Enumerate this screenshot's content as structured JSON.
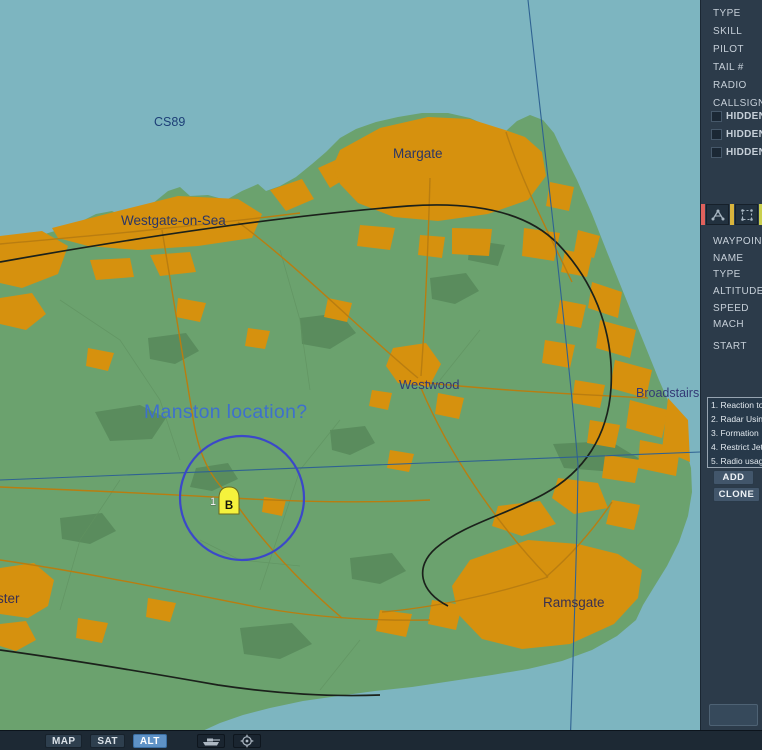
{
  "map": {
    "region_labels": {
      "cs89": "CS89",
      "margate": "Margate",
      "westgate": "Westgate-on-Sea",
      "westwood": "Westwood",
      "broadstairs": "Broadstairs",
      "ramsgate": "Ramsgate",
      "minster_partial": "ster"
    },
    "annotation": "Manston location?",
    "marker": {
      "number": "1",
      "letter": "B"
    },
    "colors": {
      "sea": "#7db5c0",
      "land": "#6ba26e",
      "woodland": "#5a8c5d",
      "urban": "#d6910e",
      "road": "#b97d10",
      "railway": "#1b211b",
      "grid_line": "#2f6292",
      "circle_annotation": "#3b48c9",
      "marker_fill": "#f5f23c",
      "town_label": "#2b3666",
      "annotation_text": "#3e70cc"
    }
  },
  "sidebar": {
    "unit_fields": [
      "TYPE",
      "SKILL",
      "PILOT",
      "TAIL #",
      "RADIO",
      "CALLSIGN"
    ],
    "hidden_rows": [
      "HIDDEN",
      "HIDDEN",
      "HIDDEN"
    ],
    "waypoint_fields": [
      "WAYPOINT",
      "NAME",
      "TYPE",
      "ALTITUDE",
      "SPEED",
      "MACH",
      "START"
    ],
    "advanced_actions": [
      "1. Reaction to",
      "2. Radar Usin",
      "3. Formation",
      "4. Restrict Jet",
      "5. Radio usag"
    ],
    "buttons": {
      "add": "ADD",
      "clone": "CLONE"
    },
    "tab_accents": {
      "route": "#e0615c",
      "select": "#d9b43c",
      "next": "#c9cf4d"
    }
  },
  "bottom_bar": {
    "map": "MAP",
    "sat": "SAT",
    "alt": "ALT"
  }
}
